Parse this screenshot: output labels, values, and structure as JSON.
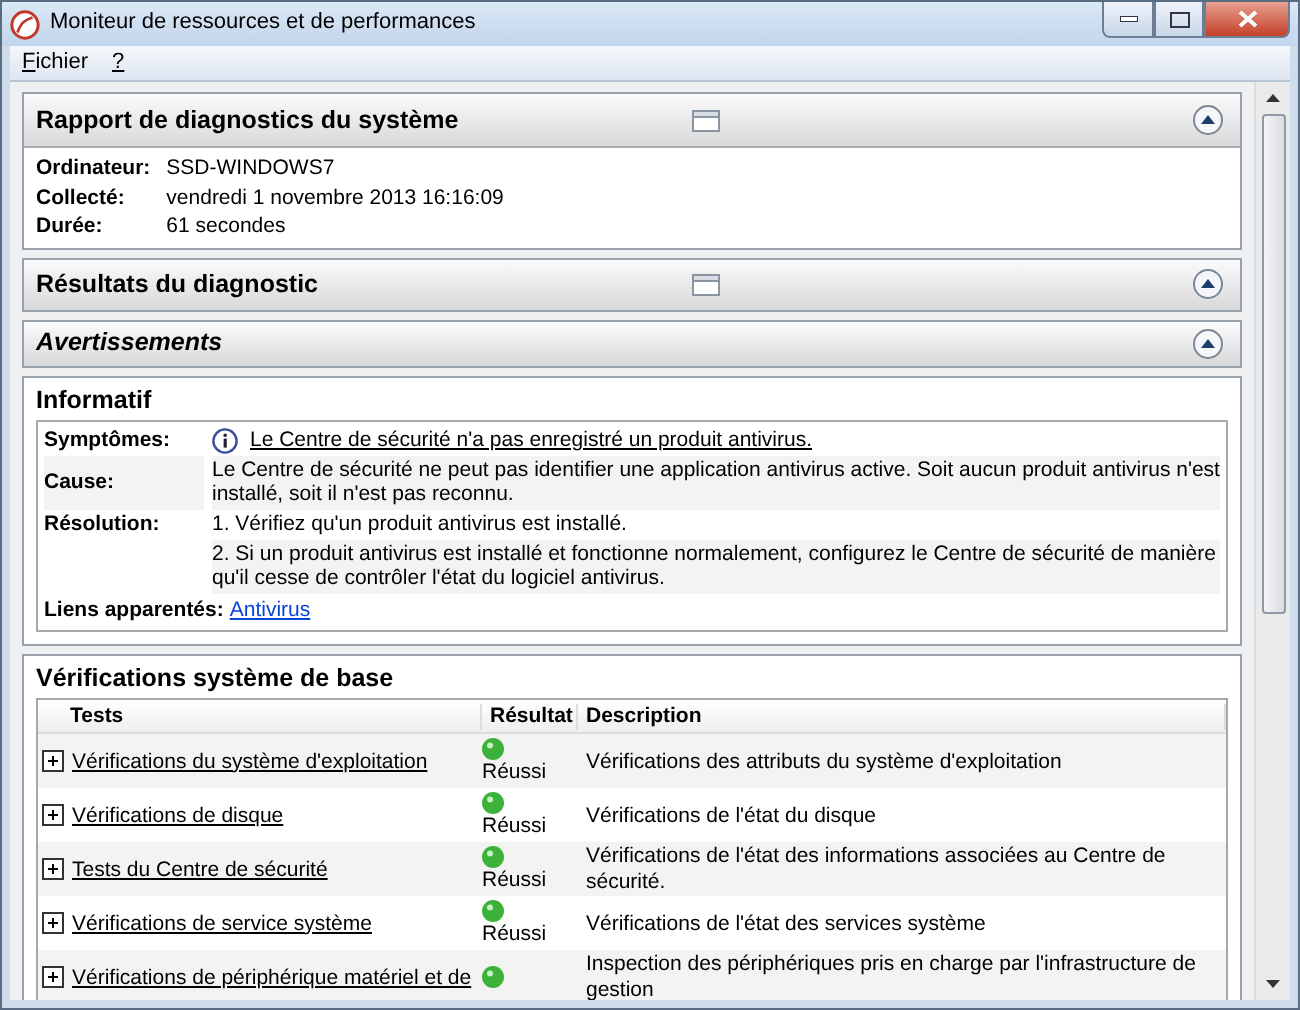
{
  "window": {
    "title": "Moniteur de ressources et de performances"
  },
  "menu": [
    {
      "label": "Fichier"
    },
    {
      "label": "?"
    }
  ],
  "report": {
    "title": "Rapport de diagnostics du système",
    "expanded": true,
    "fields": [
      {
        "label": "Ordinateur:",
        "value": "SSD-WINDOWS7"
      },
      {
        "label": "Collecté:",
        "value": "vendredi 1 novembre 2013 16:16:09"
      },
      {
        "label": "Durée:",
        "value": "61 secondes"
      }
    ]
  },
  "results": {
    "title": "Résultats du diagnostic",
    "expanded": true
  },
  "warnings": {
    "title": "Avertissements",
    "expanded": true
  },
  "informatif": {
    "title": "Informatif",
    "symptoms": {
      "label": "Symptômes:",
      "text": "Le Centre de sécurité n'a pas enregistré un produit antivirus."
    },
    "cause": {
      "label": "Cause:",
      "text": "Le Centre de sécurité ne peut pas identifier une application antivirus active. Soit aucun produit antivirus n'est installé, soit il n'est pas reconnu."
    },
    "resolution": {
      "label": "Résolution:",
      "steps": [
        "1. Vérifiez qu'un produit antivirus est installé.",
        "2. Si un produit antivirus est installé et fonctionne normalement, configurez le Centre de sécurité de manière qu'il cesse de contrôler l'état du logiciel antivirus."
      ]
    },
    "related": {
      "label": "Liens apparentés:",
      "link": "Antivirus"
    }
  },
  "checks": {
    "title": "Vérifications système de base",
    "columns": [
      "Tests",
      "Résultat",
      "Description"
    ],
    "rows": [
      {
        "test": "Vérifications du système d'exploitation",
        "color": "#3db23a",
        "result": "Réussi",
        "description": "Vérifications des attributs du système d'exploitation",
        "expanded": false
      },
      {
        "test": "Vérifications de disque",
        "color": "#3db23a",
        "result": "Réussi",
        "description": "Vérifications de l'état du disque",
        "expanded": false
      },
      {
        "test": "Tests du Centre de sécurité",
        "color": "#3db23a",
        "result": "Réussi",
        "description": "Vérifications de l'état des informations associées au Centre de sécurité.",
        "expanded": false
      },
      {
        "test": "Vérifications de service système",
        "color": "#3db23a",
        "result": "Réussi",
        "description": "Vérifications de l'état des services système",
        "expanded": false
      },
      {
        "test": "Vérifications de périphérique matériel et de",
        "color": "#3db23a",
        "description": "Inspection des périphériques pris en charge par l'infrastructure de gestion",
        "expanded": false
      }
    ]
  }
}
